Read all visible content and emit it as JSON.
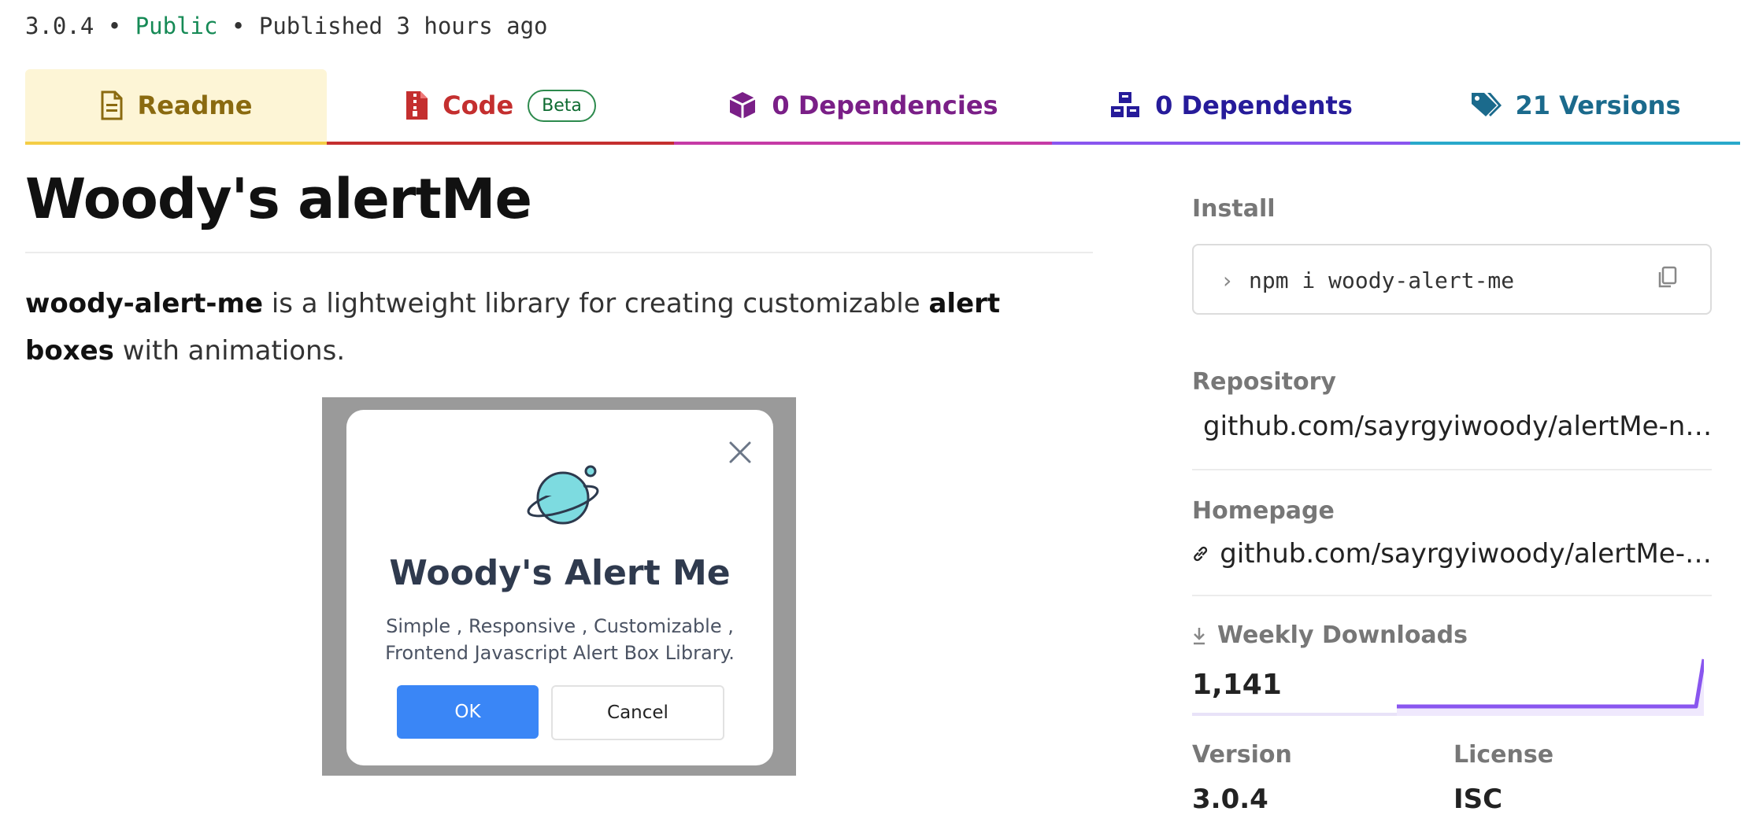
{
  "meta": {
    "version": "3.0.4",
    "sep1": " • ",
    "visibility": "Public",
    "sep2": " • ",
    "published": "Published 3 hours ago"
  },
  "tabs": {
    "readme": "Readme",
    "code": "Code",
    "code_badge": "Beta",
    "dependencies": "0 Dependencies",
    "dependents": "0 Dependents",
    "versions": "21 Versions"
  },
  "main": {
    "title": "Woody's alertMe",
    "desc_pkg": "woody-alert-me",
    "desc_mid": " is a lightweight library for creating customizable ",
    "desc_bold": "alert boxes",
    "desc_end": " with animations."
  },
  "preview": {
    "title": "Woody's Alert Me",
    "subtitle_line1": "Simple , Responsive , Customizable ,",
    "subtitle_line2": "Frontend Javascript Alert Box Library.",
    "ok": "OK",
    "cancel": "Cancel"
  },
  "sidebar": {
    "install_label": "Install",
    "install_prompt": "›",
    "install_cmd": "npm i woody-alert-me",
    "repository_label": "Repository",
    "repository_url": "github.com/sayrgyiwoody/alertMe-n…",
    "homepage_label": "Homepage",
    "homepage_url": "github.com/sayrgyiwoody/alertMe-…",
    "weekly_downloads_label": "Weekly Downloads",
    "weekly_downloads": "1,141",
    "version_label": "Version",
    "version": "3.0.4",
    "license_label": "License",
    "license": "ISC"
  },
  "colors": {
    "readme": "#8a6a10",
    "code": "#c42f2f",
    "deps": "#7a1f87",
    "dependents": "#261b9a",
    "versions": "#1b6a8c",
    "public": "#168a56",
    "ok_button": "#3a86f6",
    "sparkline": "#8956ef"
  },
  "icons": {
    "readme": "document-icon",
    "code": "zip-file-icon",
    "deps": "box-icon",
    "dependents": "boxes-icon",
    "versions": "tags-icon",
    "repo": "git-icon",
    "homepage": "link-icon",
    "downloads": "download-icon",
    "copy": "copy-icon"
  }
}
